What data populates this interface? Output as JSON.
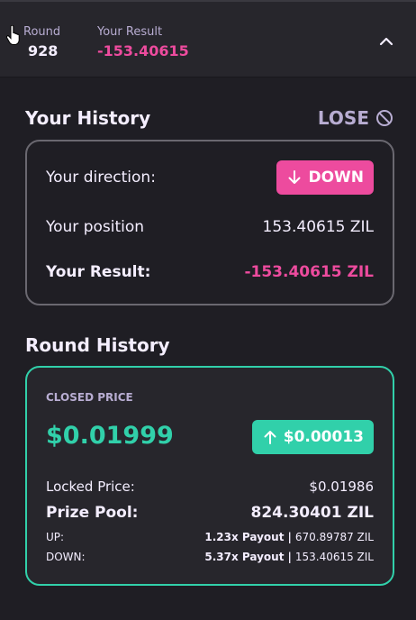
{
  "header": {
    "round_label": "Round",
    "round_value": "928",
    "result_label": "Your Result",
    "result_value": "-153.40615"
  },
  "history": {
    "title": "Your History",
    "status": "LOSE",
    "direction_label": "Your direction:",
    "direction_value": "DOWN",
    "position_label": "Your position",
    "position_value": "153.40615 ZIL",
    "result_label": "Your Result:",
    "result_value": "-153.40615 ZIL"
  },
  "round_history": {
    "title": "Round History",
    "closed_price_label": "CLOSED PRICE",
    "closed_price": "$0.01999",
    "price_change": "$0.00013",
    "locked_price_label": "Locked Price:",
    "locked_price": "$0.01986",
    "prize_pool_label": "Prize Pool:",
    "prize_pool": "824.30401 ZIL",
    "up_label": "UP:",
    "up_payout": "1.23x Payout",
    "up_amount": "670.89787 ZIL",
    "down_label": "DOWN:",
    "down_payout": "5.37x Payout",
    "down_amount": "153.40615 ZIL"
  },
  "colors": {
    "background": "#1f1e24",
    "panel": "#27262c",
    "pink": "#ed4b9e",
    "teal": "#31d0aa",
    "muted_purple": "#b8add2"
  },
  "icons": [
    "hand-cursor-icon",
    "chevron-up-icon",
    "prohibited-icon",
    "arrow-down-icon",
    "arrow-up-icon"
  ]
}
